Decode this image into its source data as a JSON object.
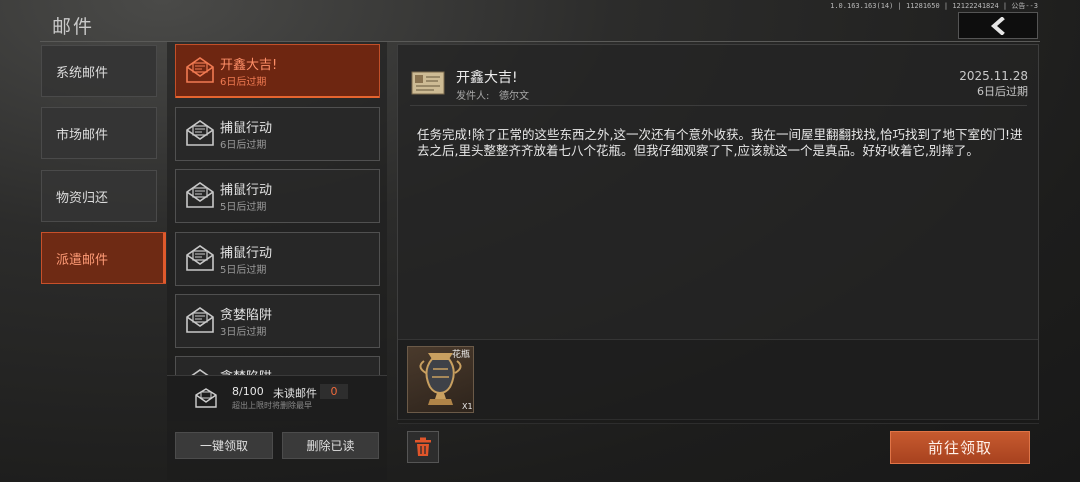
{
  "header": {
    "title": "邮件",
    "version": "1.0.163.163(14) | 11281650 | 12122241824 | 公告--3"
  },
  "categories": [
    {
      "label": "系统邮件",
      "active": false
    },
    {
      "label": "市场邮件",
      "active": false
    },
    {
      "label": "物资归还",
      "active": false
    },
    {
      "label": "派遣邮件",
      "active": true
    }
  ],
  "mails": [
    {
      "title": "开鑫大吉!",
      "expire": "6日后过期",
      "active": true
    },
    {
      "title": "捕鼠行动",
      "expire": "6日后过期",
      "active": false
    },
    {
      "title": "捕鼠行动",
      "expire": "5日后过期",
      "active": false
    },
    {
      "title": "捕鼠行动",
      "expire": "5日后过期",
      "active": false
    },
    {
      "title": "贪婪陷阱",
      "expire": "3日后过期",
      "active": false
    },
    {
      "title": "贪婪陷阱",
      "expire": "",
      "active": false
    }
  ],
  "stats": {
    "count": "8/100",
    "unread_label": "未读邮件",
    "unread_count": "0",
    "hint": "超出上限时将删除最早"
  },
  "actions": {
    "claim_all": "一键领取",
    "delete_read": "删除已读",
    "go_claim": "前往领取"
  },
  "detail": {
    "title": "开鑫大吉!",
    "sender_label": "发件人:",
    "sender": "德尔文",
    "date": "2025.11.28",
    "expire": "6日后过期",
    "body": "任务完成!除了正常的这些东西之外,这一次还有个意外收获。我在一间屋里翻翻找找,恰巧找到了地下室的门!进去之后,里头整整齐齐放着七八个花瓶。但我仔细观察了下,应该就这一个是真品。好好收着它,别摔了。",
    "attachment": {
      "name": "花瓶",
      "qty": "X1"
    }
  },
  "colors": {
    "accent": "#e05a2c",
    "accent_dark": "#7a2a10",
    "claim_button": "#c65a2f"
  },
  "icons": {
    "back": "chevron-left-icon",
    "mail": "envelope-icon",
    "letter": "letter-icon",
    "delete": "trash-icon",
    "attachment": "vase-icon"
  }
}
